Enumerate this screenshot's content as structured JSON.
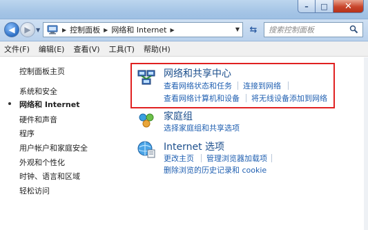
{
  "window": {
    "minimize_label": "–",
    "maximize_label": "□",
    "close_label": "✕"
  },
  "address": {
    "crumbs": [
      "控制面板",
      "网络和 Internet"
    ],
    "search_placeholder": "搜索控制面板"
  },
  "menu": {
    "items": [
      "文件(F)",
      "编辑(E)",
      "查看(V)",
      "工具(T)",
      "帮助(H)"
    ]
  },
  "sidebar": {
    "items": [
      {
        "label": "控制面板主页",
        "active": false
      },
      {
        "label": "系统和安全",
        "active": false
      },
      {
        "label": "网络和 Internet",
        "active": true
      },
      {
        "label": "硬件和声音",
        "active": false
      },
      {
        "label": "程序",
        "active": false
      },
      {
        "label": "用户帐户和家庭安全",
        "active": false
      },
      {
        "label": "外观和个性化",
        "active": false
      },
      {
        "label": "时钟、语言和区域",
        "active": false
      },
      {
        "label": "轻松访问",
        "active": false
      }
    ]
  },
  "categories": [
    {
      "title": "网络和共享中心",
      "icon": "network-sharing-icon",
      "links": [
        "查看网络状态和任务",
        "连接到网络",
        "查看网络计算机和设备",
        "将无线设备添加到网络"
      ],
      "highlighted": true
    },
    {
      "title": "家庭组",
      "icon": "homegroup-icon",
      "links": [
        "选择家庭组和共享选项"
      ]
    },
    {
      "title": "Internet 选项",
      "icon": "internet-options-icon",
      "links": [
        "更改主页",
        "管理浏览器加载项",
        "删除浏览的历史记录和 cookie"
      ]
    }
  ],
  "colors": {
    "link": "#1f5fb1",
    "title": "#1b4e8c",
    "highlight_border": "#e02020",
    "close_button": "#c8452b"
  }
}
